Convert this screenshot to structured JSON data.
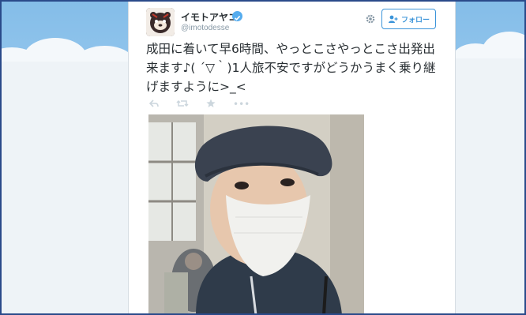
{
  "tweet": {
    "display_name": "イモトアヤコ",
    "handle": "@imotodesse",
    "verified": true,
    "text": "成田に着いて早6時間、やっとこさやっとこさ出発出来ます♪( ´▽｀)1人旅不安ですがどうかうまく乗り継げますように>_<",
    "follow_label": "フォロー"
  },
  "actions": {
    "reply_icon": "reply-icon",
    "retweet_icon": "retweet-icon",
    "favorite_icon": "star-icon",
    "more_icon": "more-icon",
    "more_glyph": "•••"
  },
  "colors": {
    "accent": "#3b94d9",
    "verified": "#55acee",
    "text": "#292f33",
    "muted": "#8899a6",
    "background": "#8fc3ea"
  }
}
